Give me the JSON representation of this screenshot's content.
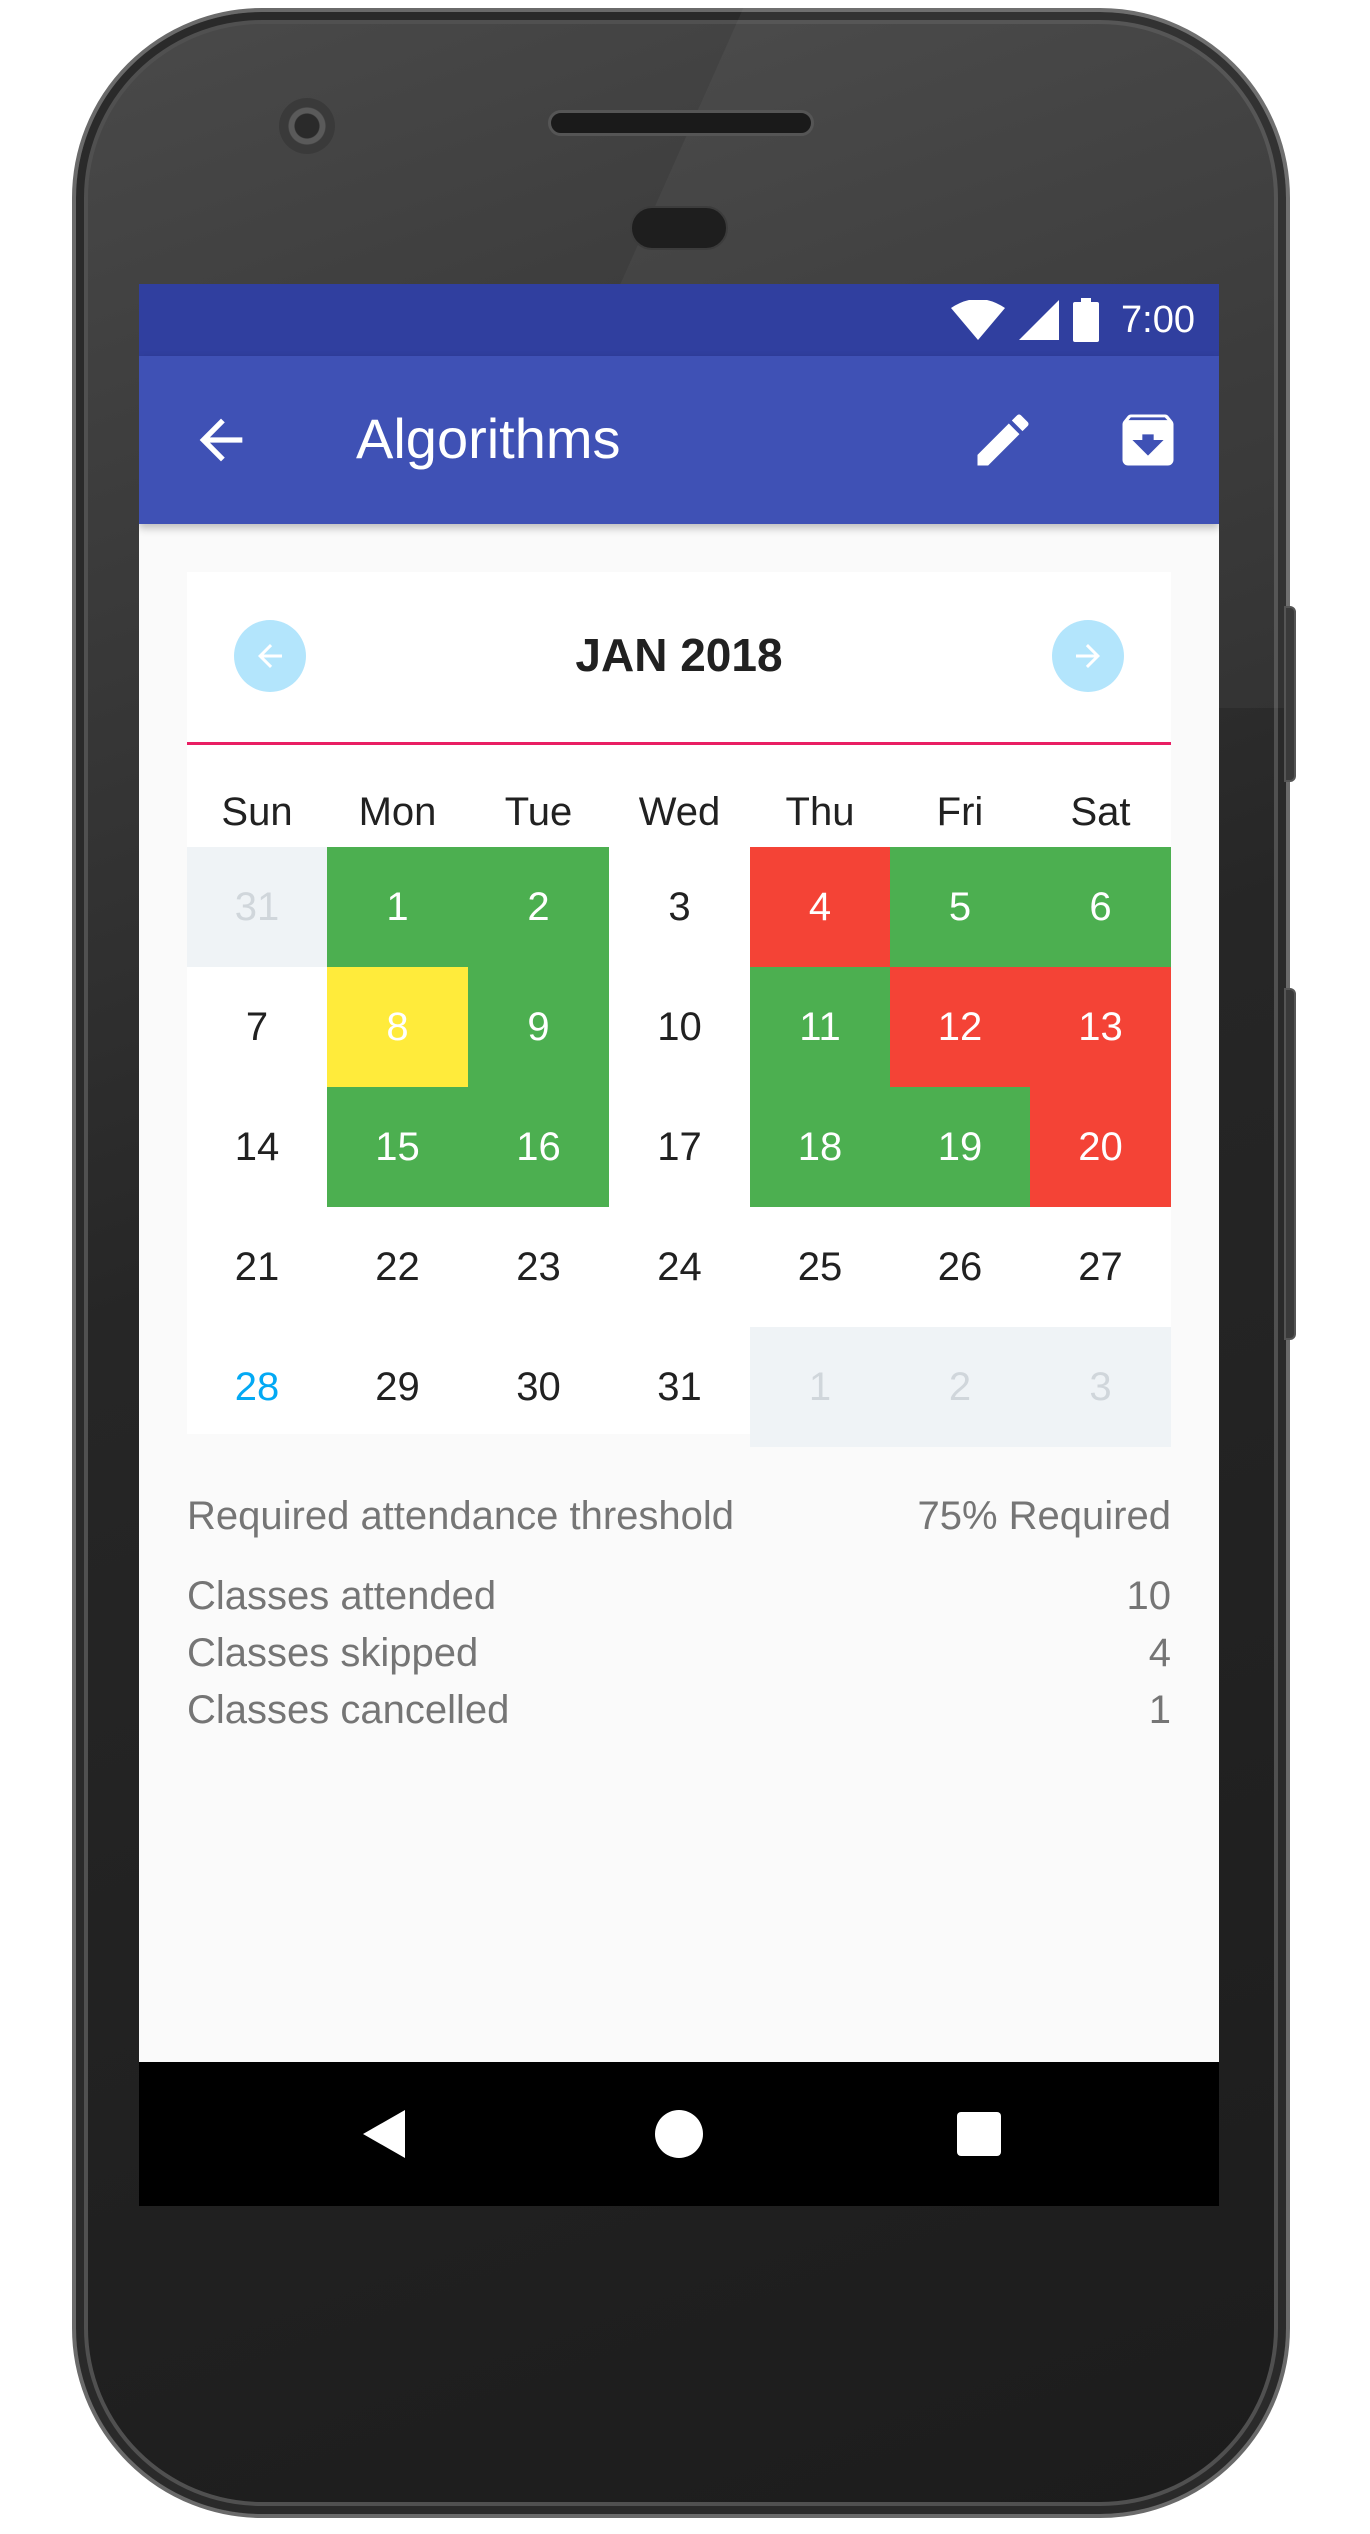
{
  "status_bar": {
    "time": "7:00",
    "icons": [
      "wifi-icon",
      "signal-icon",
      "battery-icon"
    ]
  },
  "app_bar": {
    "title": "Algorithms",
    "back_icon": "arrow-back-icon",
    "edit_icon": "pencil-icon",
    "archive_icon": "archive-icon"
  },
  "calendar": {
    "month_label": "JAN 2018",
    "prev_icon": "arrow-left-icon",
    "next_icon": "arrow-right-icon",
    "weekdays": [
      "Sun",
      "Mon",
      "Tue",
      "Wed",
      "Thu",
      "Fri",
      "Sat"
    ],
    "weeks": [
      [
        {
          "d": "31",
          "s": "outside"
        },
        {
          "d": "1",
          "s": "present"
        },
        {
          "d": "2",
          "s": "present"
        },
        {
          "d": "3",
          "s": "none"
        },
        {
          "d": "4",
          "s": "absent"
        },
        {
          "d": "5",
          "s": "present"
        },
        {
          "d": "6",
          "s": "present"
        }
      ],
      [
        {
          "d": "7",
          "s": "none"
        },
        {
          "d": "8",
          "s": "cancelled"
        },
        {
          "d": "9",
          "s": "present"
        },
        {
          "d": "10",
          "s": "none"
        },
        {
          "d": "11",
          "s": "present"
        },
        {
          "d": "12",
          "s": "absent"
        },
        {
          "d": "13",
          "s": "absent"
        }
      ],
      [
        {
          "d": "14",
          "s": "none"
        },
        {
          "d": "15",
          "s": "present"
        },
        {
          "d": "16",
          "s": "present"
        },
        {
          "d": "17",
          "s": "none"
        },
        {
          "d": "18",
          "s": "present"
        },
        {
          "d": "19",
          "s": "present"
        },
        {
          "d": "20",
          "s": "absent"
        }
      ],
      [
        {
          "d": "21",
          "s": "none"
        },
        {
          "d": "22",
          "s": "none"
        },
        {
          "d": "23",
          "s": "none"
        },
        {
          "d": "24",
          "s": "none"
        },
        {
          "d": "25",
          "s": "none"
        },
        {
          "d": "26",
          "s": "none"
        },
        {
          "d": "27",
          "s": "none"
        }
      ],
      [
        {
          "d": "28",
          "s": "today"
        },
        {
          "d": "29",
          "s": "none"
        },
        {
          "d": "30",
          "s": "none"
        },
        {
          "d": "31",
          "s": "none"
        },
        {
          "d": "1",
          "s": "outside"
        },
        {
          "d": "2",
          "s": "outside"
        },
        {
          "d": "3",
          "s": "outside"
        }
      ]
    ]
  },
  "stats": {
    "threshold_label": "Required attendance threshold",
    "threshold_value": "75% Required",
    "attended_label": "Classes attended",
    "attended_value": "10",
    "skipped_label": "Classes skipped",
    "skipped_value": "4",
    "cancelled_label": "Classes cancelled",
    "cancelled_value": "1"
  },
  "colors": {
    "status_bar": "#303f9f",
    "app_bar": "#3f51b5",
    "present": "#4caf50",
    "absent": "#f44336",
    "cancelled": "#ffeb3b",
    "today": "#03a9f4",
    "divider": "#e91e63"
  },
  "nav_bar": {
    "icons": [
      "nav-back-icon",
      "nav-home-icon",
      "nav-recents-icon"
    ]
  }
}
